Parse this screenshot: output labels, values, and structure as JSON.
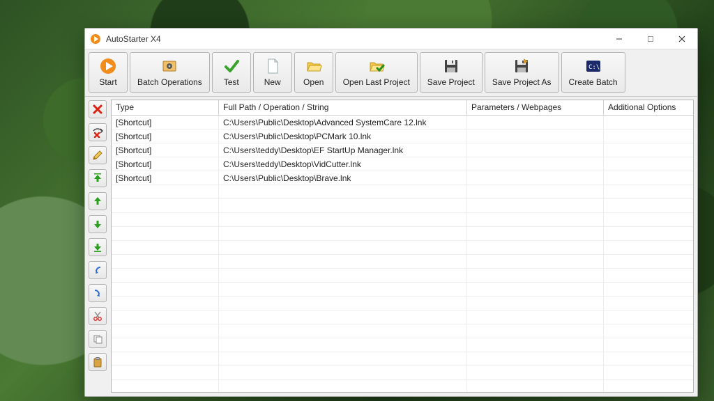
{
  "window": {
    "title": "AutoStarter X4"
  },
  "toolbar": {
    "start": "Start",
    "batch_ops": "Batch Operations",
    "test": "Test",
    "new": "New",
    "open": "Open",
    "open_last": "Open Last Project",
    "save": "Save Project",
    "save_as": "Save Project As",
    "create_batch": "Create Batch"
  },
  "columns": {
    "type": "Type",
    "path": "Full Path / Operation / String",
    "params": "Parameters / Webpages",
    "options": "Additional Options"
  },
  "rows": [
    {
      "type": "[Shortcut]",
      "path": "C:\\Users\\Public\\Desktop\\Advanced SystemCare 12.lnk",
      "params": "",
      "options": ""
    },
    {
      "type": "[Shortcut]",
      "path": "C:\\Users\\Public\\Desktop\\PCMark 10.lnk",
      "params": "",
      "options": ""
    },
    {
      "type": "[Shortcut]",
      "path": "C:\\Users\\teddy\\Desktop\\EF StartUp Manager.lnk",
      "params": "",
      "options": ""
    },
    {
      "type": "[Shortcut]",
      "path": "C:\\Users\\teddy\\Desktop\\VidCutter.lnk",
      "params": "",
      "options": ""
    },
    {
      "type": "[Shortcut]",
      "path": "C:\\Users\\Public\\Desktop\\Brave.lnk",
      "params": "",
      "options": ""
    }
  ]
}
